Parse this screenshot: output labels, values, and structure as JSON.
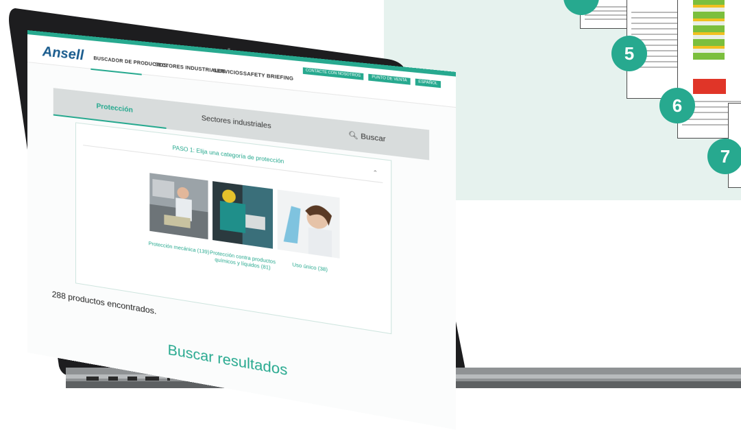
{
  "badges": [
    "5",
    "6",
    "7"
  ],
  "site": {
    "logo": "Ansell",
    "nav": [
      "BUSCADOR DE PRODUCTOS",
      "SECTORES INDUSTRIALES",
      "SERVICIOS",
      "SAFETY BRIEFING"
    ],
    "nav_right": [
      "CONTACTE CON NOSOTROS",
      "PUNTO DE VENTA",
      "ESPAÑOL"
    ]
  },
  "tabs": {
    "protection": "Protección",
    "industries": "Sectores industriales",
    "search": "Buscar"
  },
  "step": {
    "title": "PASO 1: Elija una categoría de protección",
    "categories": [
      {
        "label": "Protección mecánica (139)"
      },
      {
        "label": "Protección contra productos químicos y líquidos (81)"
      },
      {
        "label": "Uso único (38)"
      }
    ]
  },
  "results": {
    "count_text": "288 productos encontrados.",
    "heading": "Buscar resultados"
  },
  "colors": {
    "accent": "#27a98f",
    "logo": "#1a5c8e"
  }
}
